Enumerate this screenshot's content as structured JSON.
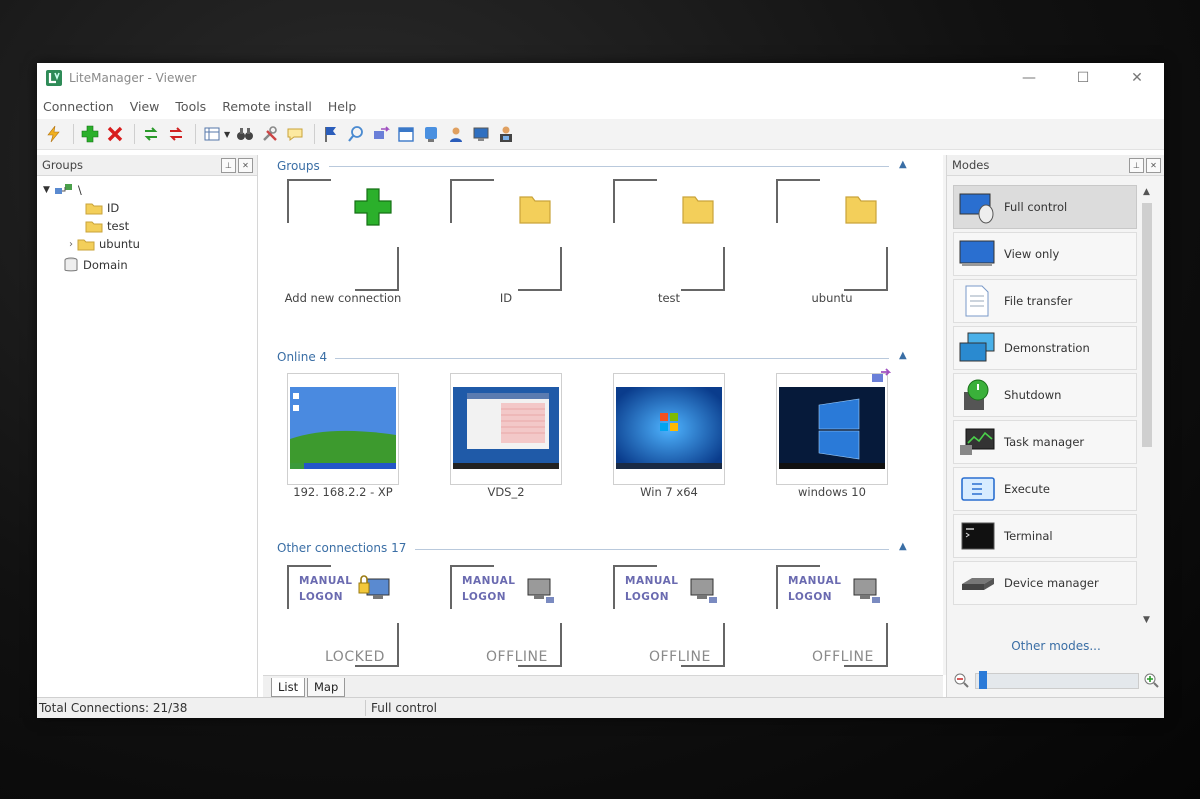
{
  "window": {
    "title": "LiteManager - Viewer",
    "controls": {
      "minimize": "—",
      "maximize": "☐",
      "close": "✕"
    }
  },
  "menu": [
    "Connection",
    "View",
    "Tools",
    "Remote install",
    "Help"
  ],
  "toolbar_icons": [
    "connect-icon",
    "add-icon",
    "delete-icon",
    "sync-green-icon",
    "sync-red-icon",
    "view-mode-icon",
    "binoculars-icon",
    "tools-icon",
    "message-icon",
    "flag-icon",
    "search-icon",
    "transfer-icon",
    "calendar-icon",
    "screen-icon",
    "user-icon",
    "monitor-icon",
    "admin-icon"
  ],
  "groups_panel": {
    "header": "Groups",
    "tree": {
      "root": "\\",
      "children": [
        "ID",
        "test",
        "ubuntu"
      ],
      "domain": "Domain"
    }
  },
  "sections": {
    "groups": {
      "title": "Groups",
      "tiles": [
        "Add new connection",
        "ID",
        "test",
        "ubuntu"
      ]
    },
    "online": {
      "title": "Online 4",
      "tiles": [
        "192. 168.2.2 - XP",
        "VDS_2",
        "Win 7 x64",
        "windows 10"
      ]
    },
    "other": {
      "title": "Other connections 17",
      "manual_line1": "MANUAL",
      "manual_line2": "LOGON",
      "tiles": [
        "LOCKED",
        "OFFLINE",
        "OFFLINE",
        "OFFLINE"
      ]
    }
  },
  "tabs": [
    "List",
    "Map"
  ],
  "modes_panel": {
    "header": "Modes",
    "items": [
      "Full control",
      "View only",
      "File transfer",
      "Demonstration",
      "Shutdown",
      "Task manager",
      "Execute",
      "Terminal",
      "Device manager"
    ],
    "other_modes": "Other modes..."
  },
  "status": {
    "connections": "Total Connections: 21/38",
    "mode": "Full control"
  },
  "colors": {
    "accent": "#3a6ea5",
    "add_green": "#2bb02b",
    "folder": "#f3cf5a"
  }
}
